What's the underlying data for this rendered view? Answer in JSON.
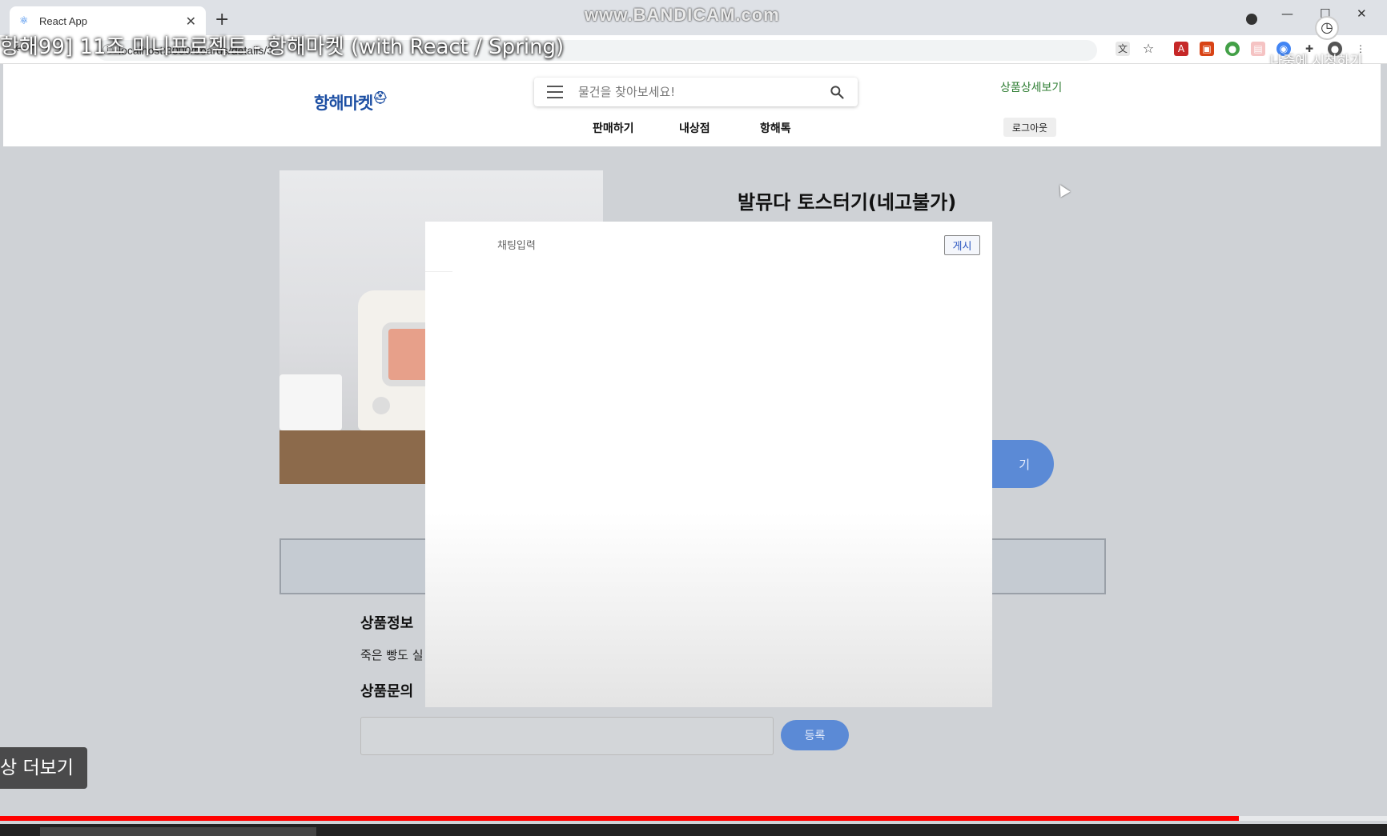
{
  "browser": {
    "tab_title": "React App",
    "tab_close": "✕",
    "new_tab": "+",
    "url": "localhost:3000/boards/details/3",
    "watermark": "www.BANDICAM.com",
    "min": "—",
    "max": "☐",
    "close": "✕"
  },
  "video": {
    "title": "항해99] 11조 미니프로젝트 - 항해마켓 (with React / Spring)",
    "watch_later": "나중에 시청하기",
    "more": "상 더보기",
    "progress": 0.893
  },
  "header": {
    "logo": "항해마켓",
    "search_placeholder": "물건을 찾아보세요!",
    "nav": [
      "판매하기",
      "내상점",
      "항해톡"
    ],
    "detail_link": "상품상세보기",
    "logout": "로그아웃"
  },
  "product": {
    "title": "발뮤다 토스터기(네고불가)",
    "chat_button": "기",
    "info_heading": "상품정보",
    "description": "죽은 빵도 실",
    "qa_heading": "상품문의",
    "register_button": "등록"
  },
  "modal": {
    "chat_placeholder": "채팅입력",
    "post_button": "게시"
  },
  "colors": {
    "accent": "#5b8ad6",
    "logo": "#1d4fa3",
    "link_green": "#2e7d32",
    "progress": "#ff0000"
  }
}
